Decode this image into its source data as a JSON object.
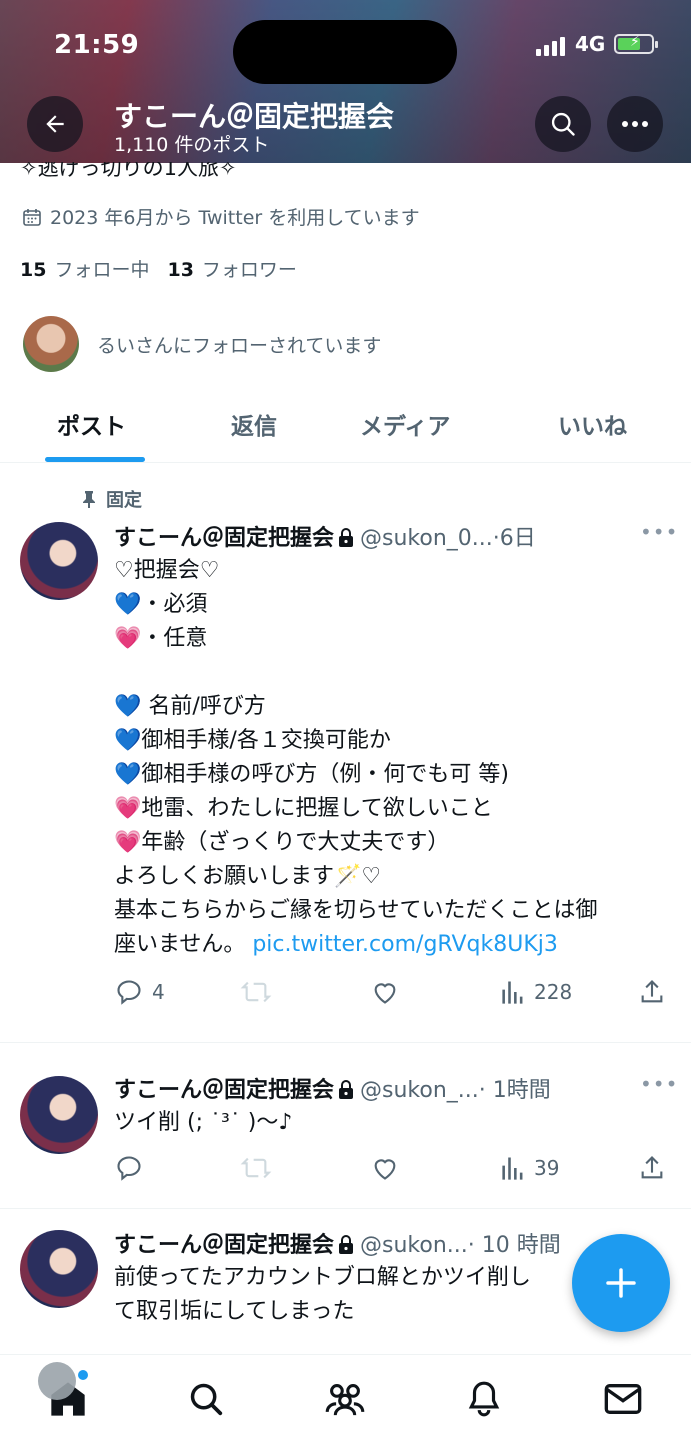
{
  "status_bar": {
    "time": "21:59",
    "network": "4G"
  },
  "header": {
    "title": "すこーん＠固定把握会",
    "subtitle": "1,110 件のポスト"
  },
  "profile": {
    "bio_partial": "✧逃げっ切りの1人旅✧",
    "joined": "2023 年6月から Twitter を利用しています",
    "following_count": "15",
    "following_label": "フォロー中",
    "followers_count": "13",
    "followers_label": "フォロワー",
    "followed_by": "るいさんにフォローされています"
  },
  "tabs": [
    {
      "label": "ポスト",
      "active": true
    },
    {
      "label": "返信",
      "active": false
    },
    {
      "label": "メディア",
      "active": false
    },
    {
      "label": "いいね",
      "active": false
    }
  ],
  "pinned_label": "固定",
  "tweets": [
    {
      "name": "すこーん＠固定把握会",
      "handle": "@sukon_0...",
      "time": "·6日",
      "lines": [
        {
          "icon": "",
          "text": "♡把握会♡"
        },
        {
          "icon": "💙",
          "text": "・必須"
        },
        {
          "icon": "💗",
          "text": "・任意"
        },
        {
          "icon": "",
          "text": ""
        },
        {
          "icon": "💙",
          "text": " 名前/呼び方"
        },
        {
          "icon": "💙",
          "text": "御相手様/各１交換可能か"
        },
        {
          "icon": "💙",
          "text": "御相手様の呼び方（例・何でも可 等)"
        },
        {
          "icon": "💗",
          "text": "地雷、わたしに把握して欲しいこと"
        },
        {
          "icon": "💗",
          "text": "年齢（ざっくりで大丈夫です）"
        },
        {
          "icon": "",
          "text": "よろしくお願いします🪄♡"
        },
        {
          "icon": "",
          "text": "基本こちらからご縁を切らせていただくことは御"
        }
      ],
      "last_line": "座いません。",
      "link": "pic.twitter.com/gRVqk8UKj3",
      "replies": "4",
      "views": "228"
    },
    {
      "name": "すこーん＠固定把握会",
      "handle": "@sukon_...",
      "time": "· 1時間",
      "text": "ツイ削 (; ˙³˙ )～♪",
      "views": "39"
    },
    {
      "name": "すこーん＠固定把握会",
      "handle": "@sukon...",
      "time": "· 10 時間",
      "lines": [
        "前使ってたアカウントブロ解とかツイ削し",
        "て取引垢にしてしまった"
      ]
    }
  ]
}
